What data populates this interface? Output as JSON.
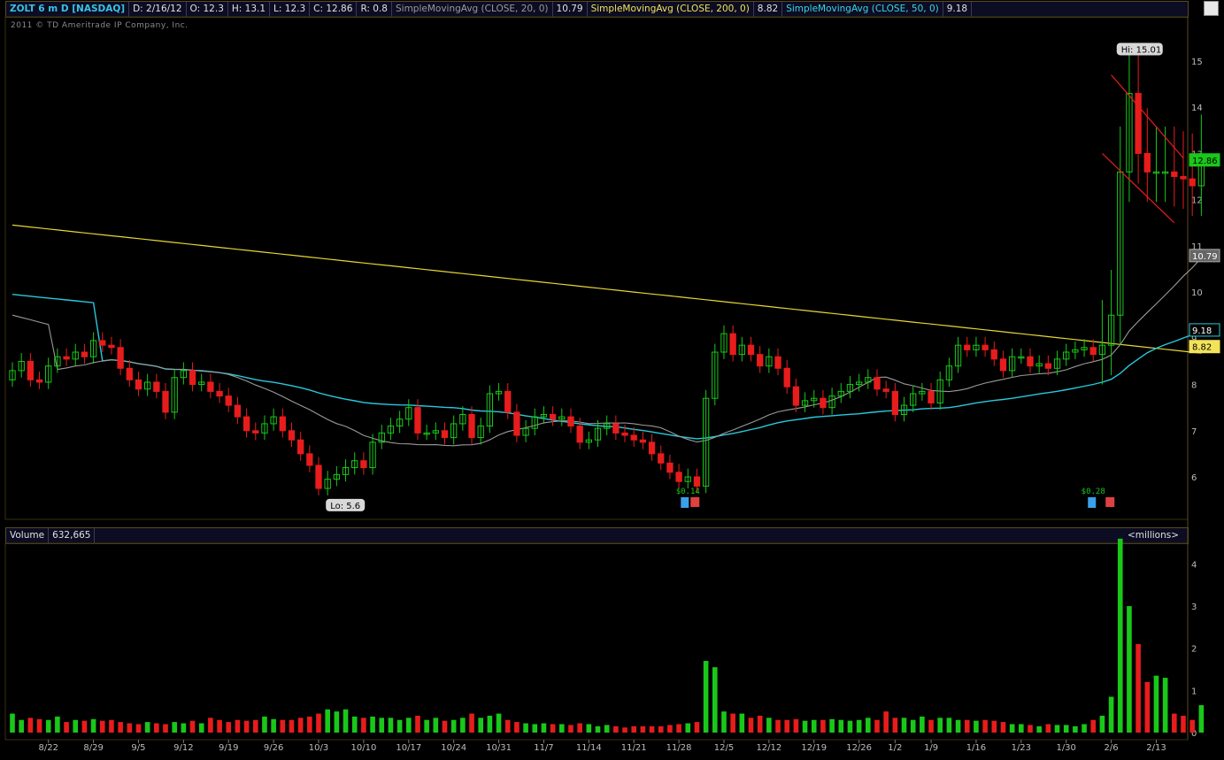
{
  "header": {
    "symbol": "ZOLT 6 m D [NASDAQ]",
    "date": "D: 2/16/12",
    "open": "O: 12.3",
    "high": "H: 13.1",
    "low": "L: 12.3",
    "close": "C: 12.86",
    "range": "R: 0.8",
    "sma20_label": "SimpleMovingAvg (CLOSE, 20, 0)",
    "sma20_value": "10.79",
    "sma200_label": "SimpleMovingAvg (CLOSE, 200, 0)",
    "sma200_value": "8.82",
    "sma50_label": "SimpleMovingAvg (CLOSE, 50, 0)",
    "sma50_value": "9.18"
  },
  "copyright": "2011 © TD Ameritrade IP Company, Inc.",
  "volume_header": {
    "label": "Volume",
    "value": "632,665",
    "unit": "<millions>"
  },
  "colors": {
    "up": "#19c819",
    "down": "#e81c1c",
    "sma20": "#9a9a9a",
    "sma50": "#29c8dc",
    "sma200": "#e6d832",
    "price_badge": "#19c819"
  },
  "chart_data": [
    {
      "type": "candlestick",
      "title": "ZOLT 6 m D [NASDAQ]",
      "y_ticks": [
        6,
        7,
        8,
        9,
        10,
        11,
        12,
        13,
        14,
        15
      ],
      "ylim": [
        5.1,
        15.9
      ],
      "x_ticks": [
        "8/22",
        "8/29",
        "9/5",
        "9/12",
        "9/19",
        "9/26",
        "10/3",
        "10/10",
        "10/17",
        "10/24",
        "10/31",
        "11/7",
        "11/14",
        "11/21",
        "11/28",
        "12/5",
        "12/12",
        "12/19",
        "12/26",
        "1/2",
        "1/9",
        "1/16",
        "1/23",
        "1/30",
        "2/6",
        "2/13"
      ],
      "x_tick_index": [
        4,
        9,
        14,
        19,
        24,
        29,
        34,
        39,
        44,
        49,
        54,
        59,
        64,
        69,
        74,
        79,
        84,
        89,
        94,
        98,
        102,
        107,
        112,
        117,
        122,
        127
      ],
      "close": [
        8.3,
        8.5,
        8.1,
        8.05,
        8.4,
        8.6,
        8.55,
        8.7,
        8.6,
        8.95,
        8.85,
        8.8,
        8.35,
        8.1,
        7.9,
        8.05,
        7.85,
        7.4,
        8.15,
        8.3,
        8.0,
        8.05,
        7.85,
        7.75,
        7.55,
        7.3,
        7.0,
        6.95,
        7.15,
        7.3,
        7.0,
        6.8,
        6.5,
        6.25,
        5.75,
        5.95,
        6.05,
        6.2,
        6.35,
        6.2,
        6.75,
        6.95,
        7.1,
        7.25,
        7.5,
        6.95,
        6.95,
        7.0,
        6.85,
        7.15,
        7.35,
        6.85,
        7.1,
        7.8,
        7.85,
        7.4,
        6.9,
        7.05,
        7.3,
        7.35,
        7.25,
        7.3,
        7.1,
        6.75,
        6.8,
        7.05,
        7.15,
        6.95,
        6.9,
        6.8,
        6.75,
        6.5,
        6.3,
        6.1,
        5.9,
        6.0,
        5.8,
        7.7,
        8.7,
        9.1,
        8.65,
        8.85,
        8.65,
        8.4,
        8.6,
        8.35,
        7.95,
        7.55,
        7.65,
        7.7,
        7.5,
        7.75,
        7.85,
        8.0,
        8.05,
        8.15,
        7.9,
        7.85,
        7.35,
        7.55,
        7.8,
        7.85,
        7.6,
        8.1,
        8.4,
        8.85,
        8.75,
        8.85,
        8.75,
        8.55,
        8.3,
        8.6,
        8.6,
        8.4,
        8.45,
        8.35,
        8.55,
        8.7,
        8.75,
        8.8,
        8.65,
        8.85,
        9.5,
        12.6,
        14.3,
        13.0,
        12.6,
        12.6,
        12.6,
        12.5,
        12.45,
        12.3,
        12.86
      ],
      "x_range": [
        0,
        130
      ],
      "annotations": [
        "Hi: 15.01",
        "Lo: 5.6",
        "$0.14",
        "$0.28"
      ],
      "price_badges": [
        "12.86",
        "10.79",
        "9.18",
        "8.82"
      ]
    },
    {
      "type": "bar",
      "title": "Volume",
      "unit": "<millions>",
      "y_ticks": [
        1,
        2,
        3,
        4
      ],
      "ylim": [
        0,
        4.45
      ],
      "values": [
        0.45,
        0.3,
        0.35,
        0.32,
        0.3,
        0.38,
        0.25,
        0.3,
        0.28,
        0.32,
        0.28,
        0.3,
        0.25,
        0.22,
        0.2,
        0.25,
        0.22,
        0.2,
        0.25,
        0.22,
        0.28,
        0.22,
        0.35,
        0.3,
        0.25,
        0.3,
        0.28,
        0.3,
        0.38,
        0.32,
        0.3,
        0.3,
        0.35,
        0.38,
        0.45,
        0.55,
        0.5,
        0.55,
        0.38,
        0.35,
        0.38,
        0.35,
        0.35,
        0.3,
        0.35,
        0.4,
        0.3,
        0.35,
        0.28,
        0.3,
        0.35,
        0.45,
        0.35,
        0.4,
        0.45,
        0.3,
        0.25,
        0.22,
        0.2,
        0.22,
        0.2,
        0.2,
        0.18,
        0.22,
        0.2,
        0.15,
        0.18,
        0.15,
        0.12,
        0.15,
        0.15,
        0.15,
        0.15,
        0.18,
        0.2,
        0.22,
        0.25,
        1.7,
        1.55,
        0.5,
        0.45,
        0.45,
        0.35,
        0.4,
        0.35,
        0.3,
        0.3,
        0.32,
        0.28,
        0.3,
        0.3,
        0.32,
        0.3,
        0.28,
        0.3,
        0.35,
        0.3,
        0.5,
        0.35,
        0.35,
        0.3,
        0.38,
        0.3,
        0.35,
        0.35,
        0.3,
        0.3,
        0.28,
        0.3,
        0.28,
        0.25,
        0.2,
        0.2,
        0.18,
        0.15,
        0.2,
        0.18,
        0.18,
        0.15,
        0.2,
        0.3,
        0.4,
        0.85,
        4.6,
        3.0,
        2.1,
        1.2,
        1.35,
        1.3,
        0.45,
        0.4,
        0.3,
        0.65
      ],
      "bar_colors": "down = red, up = green"
    }
  ]
}
